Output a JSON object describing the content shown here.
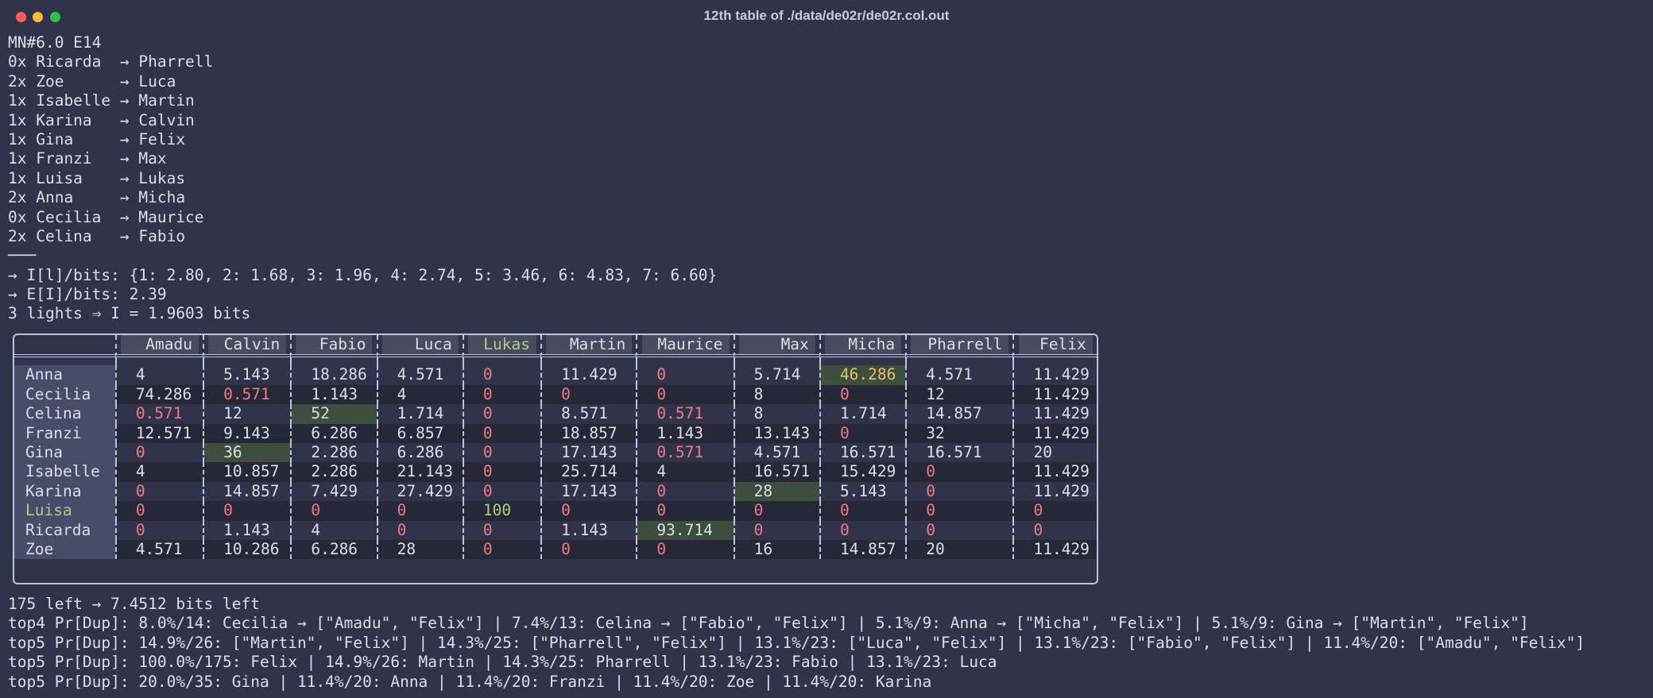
{
  "window": {
    "title": "12th table of ./data/de02r/de02r.col.out"
  },
  "header_lines": [
    "MN#6.0 E14",
    "0x Ricarda  → Pharrell",
    "2x Zoe      → Luca",
    "1x Isabelle → Martin",
    "1x Karina   → Calvin",
    "1x Gina     → Felix",
    "1x Franzi   → Max",
    "1x Luisa    → Lukas",
    "2x Anna     → Micha",
    "0x Cecilia  → Maurice",
    "2x Celina   → Fabio",
    "───",
    "→ I[l]/bits: {1: 2.80, 2: 1.68, 3: 1.96, 4: 2.74, 5: 3.46, 6: 4.83, 7: 6.60}",
    "→ E[I]/bits: 2.39",
    "3 lights ⇒ I = 1.9603 bits"
  ],
  "table": {
    "columns": [
      "Amadu",
      "Calvin",
      "Fabio",
      "Luca",
      "Lukas",
      "Martin",
      "Maurice",
      "Max",
      "Micha",
      "Pharrell",
      "Felix"
    ],
    "rows": [
      {
        "name": "Anna",
        "cells": [
          "4",
          "5.143",
          "18.286",
          "4.571",
          "0",
          "11.429",
          "0",
          "5.714",
          "46.286",
          "4.571",
          "11.429"
        ]
      },
      {
        "name": "Cecilia",
        "cells": [
          "74.286",
          "0.571",
          "1.143",
          "4",
          "0",
          "0",
          "0",
          "8",
          "0",
          "12",
          "11.429"
        ]
      },
      {
        "name": "Celina",
        "cells": [
          "0.571",
          "12",
          "52",
          "1.714",
          "0",
          "8.571",
          "0.571",
          "8",
          "1.714",
          "14.857",
          "11.429"
        ]
      },
      {
        "name": "Franzi",
        "cells": [
          "12.571",
          "9.143",
          "6.286",
          "6.857",
          "0",
          "18.857",
          "1.143",
          "13.143",
          "0",
          "32",
          "11.429"
        ]
      },
      {
        "name": "Gina",
        "cells": [
          "0",
          "36",
          "2.286",
          "6.286",
          "0",
          "17.143",
          "0.571",
          "4.571",
          "16.571",
          "16.571",
          "20"
        ]
      },
      {
        "name": "Isabelle",
        "cells": [
          "4",
          "10.857",
          "2.286",
          "21.143",
          "0",
          "25.714",
          "4",
          "16.571",
          "15.429",
          "0",
          "11.429"
        ]
      },
      {
        "name": "Karina",
        "cells": [
          "0",
          "14.857",
          "7.429",
          "27.429",
          "0",
          "17.143",
          "0",
          "28",
          "5.143",
          "0",
          "11.429"
        ]
      },
      {
        "name": "Luisa",
        "cells": [
          "0",
          "0",
          "0",
          "0",
          "100",
          "0",
          "0",
          "0",
          "0",
          "0",
          "0"
        ]
      },
      {
        "name": "Ricarda",
        "cells": [
          "0",
          "1.143",
          "4",
          "0",
          "0",
          "1.143",
          "93.714",
          "0",
          "0",
          "0",
          "0"
        ]
      },
      {
        "name": "Zoe",
        "cells": [
          "4.571",
          "10.286",
          "6.286",
          "28",
          "0",
          "0",
          "0",
          "16",
          "14.857",
          "20",
          "11.429"
        ]
      }
    ]
  },
  "footer_lines": [
    "175 left → 7.4512 bits left",
    "top4 Pr[Dup]: 8.0%/14: Cecilia → [\"Amadu\", \"Felix\"] | 7.4%/13: Celina → [\"Fabio\", \"Felix\"] | 5.1%/9: Anna → [\"Micha\", \"Felix\"] | 5.1%/9: Gina → [\"Martin\", \"Felix\"]",
    "top5 Pr[Dup]: 14.9%/26: [\"Martin\", \"Felix\"] | 14.3%/25: [\"Pharrell\", \"Felix\"] | 13.1%/23: [\"Luca\", \"Felix\"] | 13.1%/23: [\"Fabio\", \"Felix\"] | 11.4%/20: [\"Amadu\", \"Felix\"]",
    "top5 Pr[Dup]: 100.0%/175: Felix | 14.9%/26: Martin | 14.3%/25: Pharrell | 13.1%/23: Fabio | 13.1%/23: Luca",
    "top5 Pr[Dup]: 20.0%/35: Gina | 11.4%/20: Anna | 11.4%/20: Franzi | 11.4%/20: Zoe | 11.4%/20: Karina"
  ]
}
